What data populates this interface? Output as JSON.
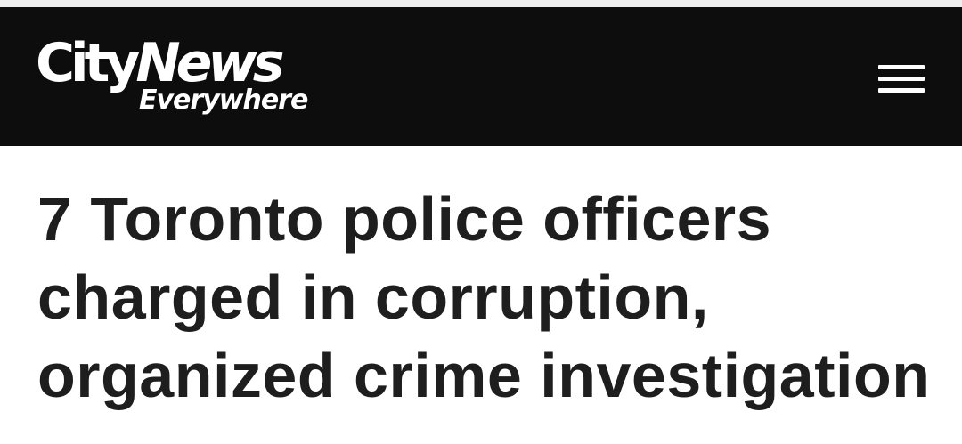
{
  "brand": {
    "logo_city": "City",
    "logo_news": "News",
    "logo_tagline": "Everywhere",
    "colors": {
      "header_bg": "#0d0d0d",
      "logo_text": "#ffffff",
      "headline_text": "#1e1e1e"
    }
  },
  "header": {
    "menu_icon": "hamburger-menu-icon"
  },
  "article": {
    "headline_lines": [
      "7 Toronto police officers",
      "charged in corruption,",
      "organized crime investigation"
    ]
  }
}
